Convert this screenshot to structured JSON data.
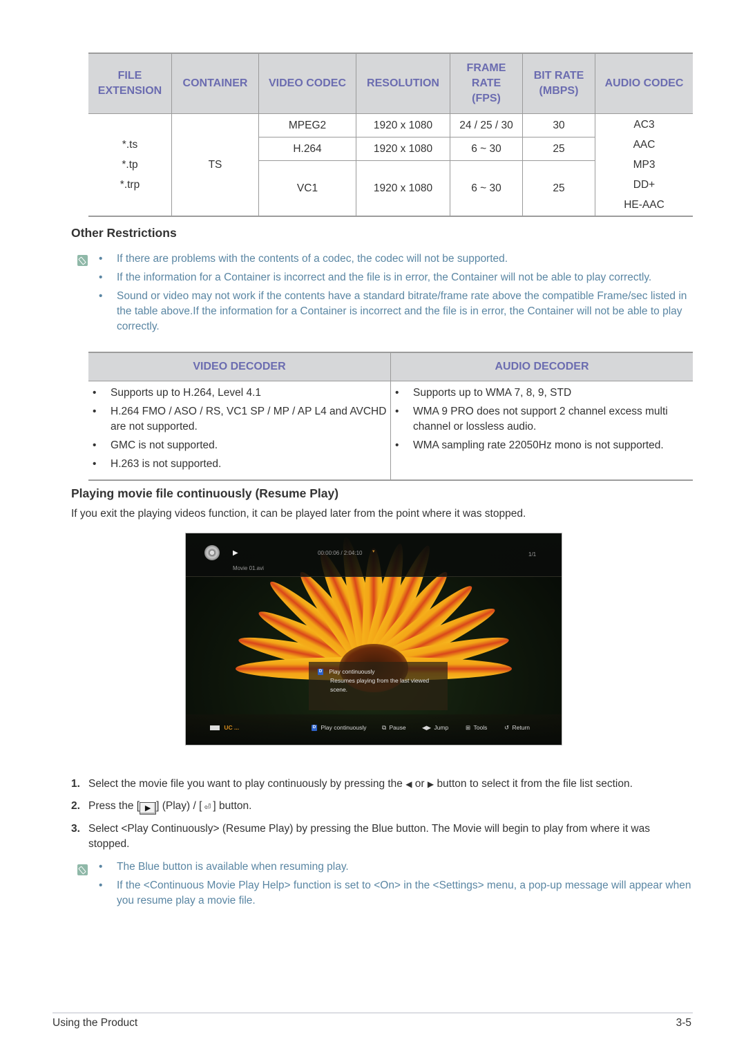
{
  "spec_table": {
    "headers": [
      "FILE EXTENSION",
      "CONTAINER",
      "VIDEO CODEC",
      "RESOLUTION",
      "FRAME RATE (FPS)",
      "BIT RATE (MBPS)",
      "AUDIO CODEC"
    ],
    "header_lines": {
      "file_extension": [
        "FILE",
        "EXTENSION"
      ],
      "container": "CONTAINER",
      "video_codec": "VIDEO CODEC",
      "resolution": "RESOLUTION",
      "frame_rate": [
        "FRAME",
        "RATE",
        "(FPS)"
      ],
      "bit_rate": [
        "BIT RATE",
        "(MBPS)"
      ],
      "audio_codec": "AUDIO CODEC"
    },
    "file_extensions": [
      "*.ts",
      "*.tp",
      "*.trp"
    ],
    "container": "TS",
    "rows": [
      {
        "video_codec": "MPEG2",
        "resolution": "1920 x 1080",
        "frame_rate": "24 / 25 / 30",
        "bit_rate": "30"
      },
      {
        "video_codec": "H.264",
        "resolution": "1920 x 1080",
        "frame_rate": "6 ~ 30",
        "bit_rate": "25"
      },
      {
        "video_codec": "VC1",
        "resolution": "1920 x 1080",
        "frame_rate": "6 ~ 30",
        "bit_rate": "25"
      }
    ],
    "audio_codecs": [
      "AC3",
      "AAC",
      "MP3",
      "DD+",
      "HE-AAC"
    ]
  },
  "other_restrictions": {
    "title": "Other Restrictions",
    "icon": "note-pencil-icon",
    "items": [
      "If there are problems with the contents of a codec, the codec will not be supported.",
      "If the information for a Container is incorrect and the file is in error, the Container will not be able to play correctly.",
      "Sound or video may not work if the contents have a standard bitrate/frame rate above the compatible Frame/sec listed in the table above.If the information for a Container is incorrect and the file is in error, the Container will not be able to play correctly."
    ]
  },
  "decoder_table": {
    "video_header": "VIDEO DECODER",
    "audio_header": "AUDIO DECODER",
    "video_items": [
      "Supports up to H.264, Level 4.1",
      "H.264 FMO / ASO / RS, VC1 SP / MP / AP L4 and AVCHD are not supported.",
      "GMC is not supported.",
      "H.263 is not supported."
    ],
    "audio_items": [
      "Supports up to WMA 7, 8, 9, STD",
      "WMA 9 PRO does not support 2 channel excess multi channel or lossless audio.",
      "WMA sampling rate 22050Hz mono is not supported."
    ]
  },
  "resume_section": {
    "title": "Playing movie file continuously (Resume Play)",
    "intro": "If you exit the playing videos function, it can be played later from the point where it was stopped."
  },
  "player_screenshot": {
    "play_state": "▶",
    "time": "00:00:06 / 2:04:10",
    "page": "1/1",
    "filename": "Movie 01.avi",
    "popup": {
      "badge": "D",
      "title": "Play continuously",
      "description": "Resumes playing from the last viewed scene."
    },
    "device_label": "UC ...",
    "bottom_bar": {
      "play_continuously": "Play continuously",
      "pause": "Pause",
      "jump": "Jump",
      "tools": "Tools",
      "return": "Return"
    }
  },
  "steps": [
    {
      "num": "1.",
      "text_a": "Select the movie file you want to play continuously by pressing the",
      "left_arrow": "◀",
      "or": "or",
      "right_arrow": "▶",
      "text_b": "button to select it from the file list section."
    },
    {
      "num": "2.",
      "text_a": "Press the [",
      "play_key": "▶",
      "text_b": "] (Play) / [",
      "enter_key": "⏎",
      "text_c": "] button."
    },
    {
      "num": "3.",
      "text": "Select <Play Continuously> (Resume Play) by pressing the Blue button. The Movie will begin to play from where it was stopped."
    }
  ],
  "resume_notes": [
    "The Blue button is available when resuming play.",
    "If the <Continuous Movie Play Help> function is set to <On> in the <Settings> menu, a pop-up message will appear when you resume play a movie file."
  ],
  "footer": {
    "section": "Using the Product",
    "page": "3-5"
  }
}
